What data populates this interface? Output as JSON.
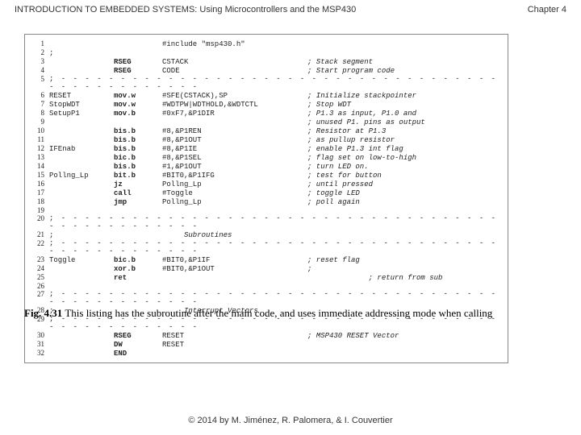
{
  "header": {
    "title": "INTRODUCTION TO EMBEDDED SYSTEMS: Using Microcontrollers and the MSP430",
    "chapter": "Chapter 4"
  },
  "listing": {
    "lines": [
      {
        "n": "1",
        "label": "",
        "op": "",
        "arg": "#include \"msp430.h\"",
        "cmt": ""
      },
      {
        "n": "2",
        "label": ";",
        "op": "",
        "arg": "",
        "cmt": ""
      },
      {
        "n": "3",
        "label": "",
        "op": "RSEG",
        "arg": "CSTACK",
        "cmt": "; Stack segment"
      },
      {
        "n": "4",
        "label": "",
        "op": "RSEG",
        "arg": "CODE",
        "cmt": "; Start program code"
      },
      {
        "n": "5",
        "dash": true
      },
      {
        "n": "6",
        "label": "RESET",
        "op": "mov.w",
        "arg": "#SFE(CSTACK),SP",
        "cmt": "; Initialize stackpointer"
      },
      {
        "n": "7",
        "label": "StopWDT",
        "op": "mov.w",
        "arg": "#WDTPW|WDTHOLD,&WDTCTL",
        "cmt": "; Stop WDT"
      },
      {
        "n": "8",
        "label": "SetupP1",
        "op": "mov.b",
        "arg": "#0xF7,&P1DIR",
        "cmt": "; P1.3 as input, P1.0 and"
      },
      {
        "n": "9",
        "label": "",
        "op": "",
        "arg": "",
        "cmt": "; unused P1. pins as output"
      },
      {
        "n": "10",
        "label": "",
        "op": "bis.b",
        "arg": "#8,&P1REN",
        "cmt": "; Resistor at P1.3"
      },
      {
        "n": "11",
        "label": "",
        "op": "bis.b",
        "arg": "#8,&P1OUT",
        "cmt": "; as pullup resistor"
      },
      {
        "n": "12",
        "label": "IFEnab",
        "op": "bis.b",
        "arg": "#8,&P1IE",
        "cmt": "; enable P1.3 int flag"
      },
      {
        "n": "13",
        "label": "",
        "op": "bic.b",
        "arg": "#8,&P1SEL",
        "cmt": "; flag set on low-to-high"
      },
      {
        "n": "14",
        "label": "",
        "op": "bis.b",
        "arg": "#1,&P1OUT",
        "cmt": "; turn LED on."
      },
      {
        "n": "15",
        "label": "Pollng_Lp",
        "op": "bit.b",
        "arg": "#BIT0,&P1IFG",
        "cmt": "; test for button"
      },
      {
        "n": "16",
        "label": "",
        "op": "jz",
        "arg": "Pollng_Lp",
        "cmt": "; until pressed"
      },
      {
        "n": "17",
        "label": "",
        "op": "call",
        "arg": "#Toggle",
        "cmt": "; toggle LED"
      },
      {
        "n": "18",
        "label": "",
        "op": "jmp",
        "arg": "Pollng_Lp",
        "cmt": "; poll again"
      },
      {
        "n": "19",
        "label": "",
        "op": "",
        "arg": "",
        "cmt": ""
      },
      {
        "n": "20",
        "dash": true
      },
      {
        "n": "21",
        "label": ";",
        "op": "",
        "arg": "     Subroutines",
        "cmt": "",
        "ital": true
      },
      {
        "n": "22",
        "dash": true
      },
      {
        "n": "23",
        "label": "Toggle",
        "op": "bic.b",
        "arg": "#BIT0,&P1IF",
        "cmt": "; reset flag"
      },
      {
        "n": "24",
        "label": "",
        "op": "xor.b",
        "arg": "#BIT0,&P1OUT",
        "cmt": ";"
      },
      {
        "n": "25",
        "label": "",
        "op": "ret",
        "arg": "",
        "cmt": "              ; return from sub"
      },
      {
        "n": "26",
        "label": "",
        "op": "",
        "arg": "",
        "cmt": ""
      },
      {
        "n": "27",
        "dash": true
      },
      {
        "n": "28",
        "label": ";",
        "op": "",
        "arg": "     Interrupt Vectors",
        "cmt": "",
        "ital": true
      },
      {
        "n": "29",
        "dash": true
      },
      {
        "n": "30",
        "label": "",
        "op": "RSEG",
        "arg": "RESET",
        "cmt": "; MSP430 RESET Vector"
      },
      {
        "n": "31",
        "label": "",
        "op": "DW",
        "arg": "RESET",
        "cmt": ""
      },
      {
        "n": "32",
        "label": "",
        "op": "END",
        "arg": "",
        "cmt": ""
      }
    ]
  },
  "caption": {
    "label": "Fig. 4.31",
    "text": "  This listing has the subroutine after the main code, and uses immediate addressing mode when calling"
  },
  "footer": "© 2014 by M. Jiménez, R. Palomera, & I. Couvertier"
}
